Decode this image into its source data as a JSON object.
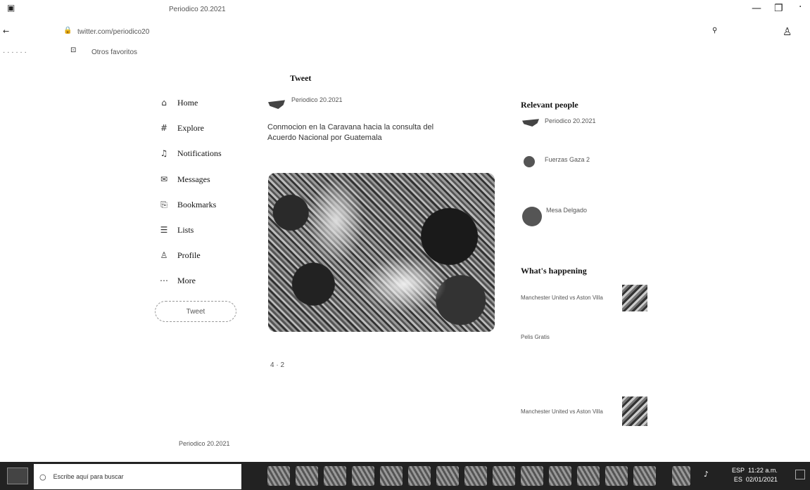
{
  "window": {
    "title": "Periodico 20.2021",
    "minimize": "—",
    "restore": "❐",
    "close": "·"
  },
  "address": {
    "url": "twitter.com/periodico20",
    "extension_icon": "puzzle-icon",
    "profile_icon": "person-icon"
  },
  "bookmarks": {
    "label": "Otros favoritos"
  },
  "nav": {
    "items": [
      {
        "label": "Home",
        "icon": "home-icon",
        "glyph": "⌂"
      },
      {
        "label": "Explore",
        "icon": "hashtag-icon",
        "glyph": "#"
      },
      {
        "label": "Notifications",
        "icon": "bell-icon",
        "glyph": "🔔"
      },
      {
        "label": "Messages",
        "icon": "envelope-icon",
        "glyph": "✉"
      },
      {
        "label": "Bookmarks",
        "icon": "bookmark-icon",
        "glyph": "⎘"
      },
      {
        "label": "Lists",
        "icon": "list-icon",
        "glyph": "☰"
      },
      {
        "label": "Profile",
        "icon": "person-icon",
        "glyph": "♙"
      },
      {
        "label": "More",
        "icon": "more-icon",
        "glyph": "⋯"
      }
    ],
    "tweet_button": "Tweet",
    "account_name": "Periodico 20.2021"
  },
  "tweet": {
    "header": "Tweet",
    "author": "Periodico 20.2021",
    "text_line1": "Conmocion en la Caravana hacia la consulta del",
    "text_line2": "Acuerdo Nacional por Guatemala",
    "text_line3": "",
    "text_line4": "",
    "footer_text": "",
    "stats": "4 · 2"
  },
  "relevant": {
    "title": "Relevant people",
    "people": [
      {
        "name": "Periodico 20.2021",
        "bio": ""
      },
      {
        "name": "Fuerzas Gaza 2",
        "bio": ""
      },
      {
        "name": "Mesa Delgado",
        "bio": ""
      }
    ]
  },
  "happening": {
    "title": "What's happening",
    "items": [
      {
        "meta": "",
        "headline": "Manchester United vs Aston Villa"
      },
      {
        "meta": "",
        "headline": "Pelis Gratis"
      },
      {
        "meta": "",
        "headline": ""
      },
      {
        "meta": "",
        "headline": "Manchester United vs Aston Villa"
      },
      {
        "meta": "",
        "headline": ""
      }
    ]
  },
  "taskbar": {
    "search_placeholder": "Escribe aquí para buscar",
    "language": "ESP",
    "region": "ES",
    "time": "11:22 a.m.",
    "date": "02/01/2021"
  }
}
